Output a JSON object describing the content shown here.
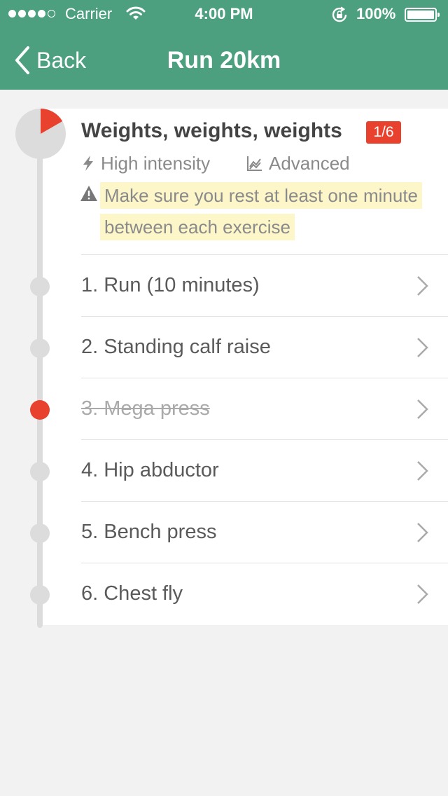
{
  "status_bar": {
    "carrier": "Carrier",
    "time": "4:00 PM",
    "battery": "100%",
    "signal_bars_filled": 4,
    "signal_bars_total": 5
  },
  "nav": {
    "back_label": "Back",
    "title": "Run 20km"
  },
  "workout": {
    "title": "Weights, weights, weights",
    "progress_badge": "1/6",
    "progress_fraction": 0.1667,
    "intensity": "High intensity",
    "level": "Advanced",
    "warning": "Make sure you rest at least one minute between each exercise"
  },
  "exercises": [
    {
      "label": "1. Run (10 minutes)",
      "done": false
    },
    {
      "label": "2. Standing calf raise",
      "done": false
    },
    {
      "label": "3. Mega press",
      "done": true
    },
    {
      "label": "4. Hip abductor",
      "done": false
    },
    {
      "label": "5. Bench press",
      "done": false
    },
    {
      "label": "6. Chest fly",
      "done": false
    }
  ],
  "colors": {
    "header": "#4ca07f",
    "accent": "#e8422f",
    "rail": "#dcdcdc",
    "highlight": "#fdf6c8"
  },
  "icons": {
    "back": "chevron-left-icon",
    "intensity": "lightning-icon",
    "level": "chart-icon",
    "warning": "warning-triangle-icon",
    "row": "chevron-right-icon"
  }
}
